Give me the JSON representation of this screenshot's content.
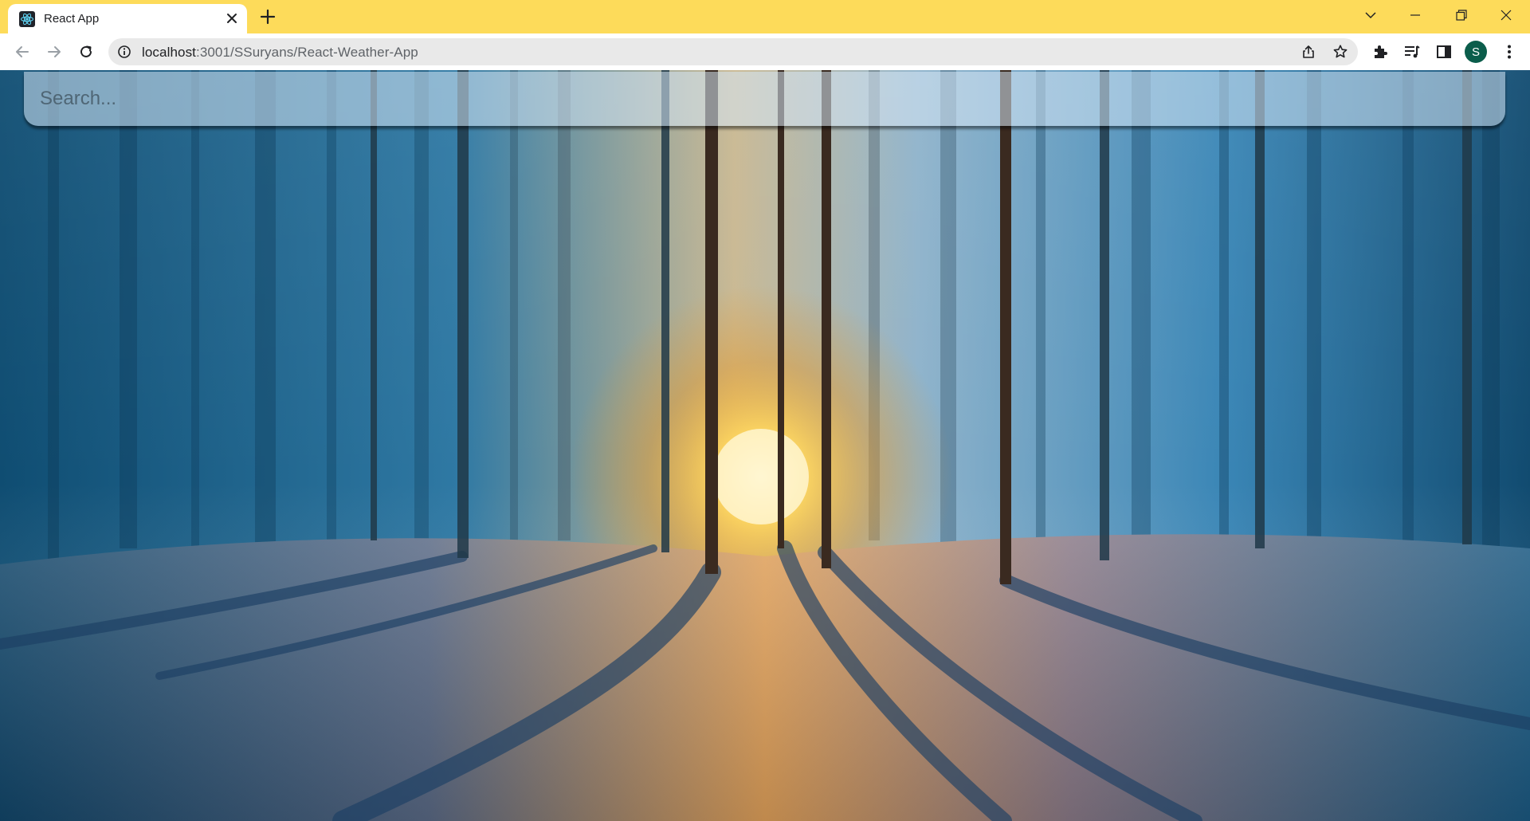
{
  "browser": {
    "tab": {
      "title": "React App",
      "favicon": "react-logo-icon"
    },
    "address_bar": {
      "url_host": "localhost",
      "url_path": ":3001/SSuryans/React-Weather-App"
    },
    "profile_initial": "S",
    "colors": {
      "titlebar": "#fddb5a",
      "avatar": "#0b5d4b"
    }
  },
  "app": {
    "search": {
      "placeholder": "Search..."
    },
    "background": "winter-forest-sunset-image"
  }
}
